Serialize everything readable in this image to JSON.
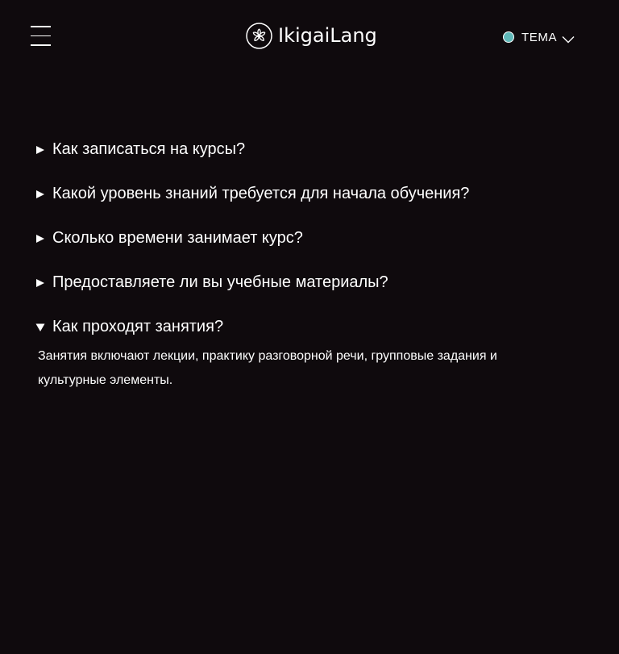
{
  "header": {
    "menu_icon": "hamburger-menu-icon",
    "logo": {
      "icon": "flower-icon",
      "text": "IkigaiLang"
    },
    "theme": {
      "dot_color": "#5fb8b8",
      "label": "ТЕМА",
      "icon": "chevron-down-icon"
    }
  },
  "faq": {
    "items": [
      {
        "question": "Как записаться на курсы?",
        "open": false
      },
      {
        "question": "Какой уровень знаний требуется для начала обучения?",
        "open": false
      },
      {
        "question": "Сколько времени занимает курс?",
        "open": false
      },
      {
        "question": "Предоставляете ли вы учебные материалы?",
        "open": false
      },
      {
        "question": "Как проходят занятия?",
        "open": true,
        "answer": "Занятия включают лекции, практику разговорной речи, групповые задания и культурные элементы."
      }
    ]
  },
  "colors": {
    "background": "#0f0a0d",
    "text": "#ffffff",
    "accent": "#5fb8b8"
  }
}
